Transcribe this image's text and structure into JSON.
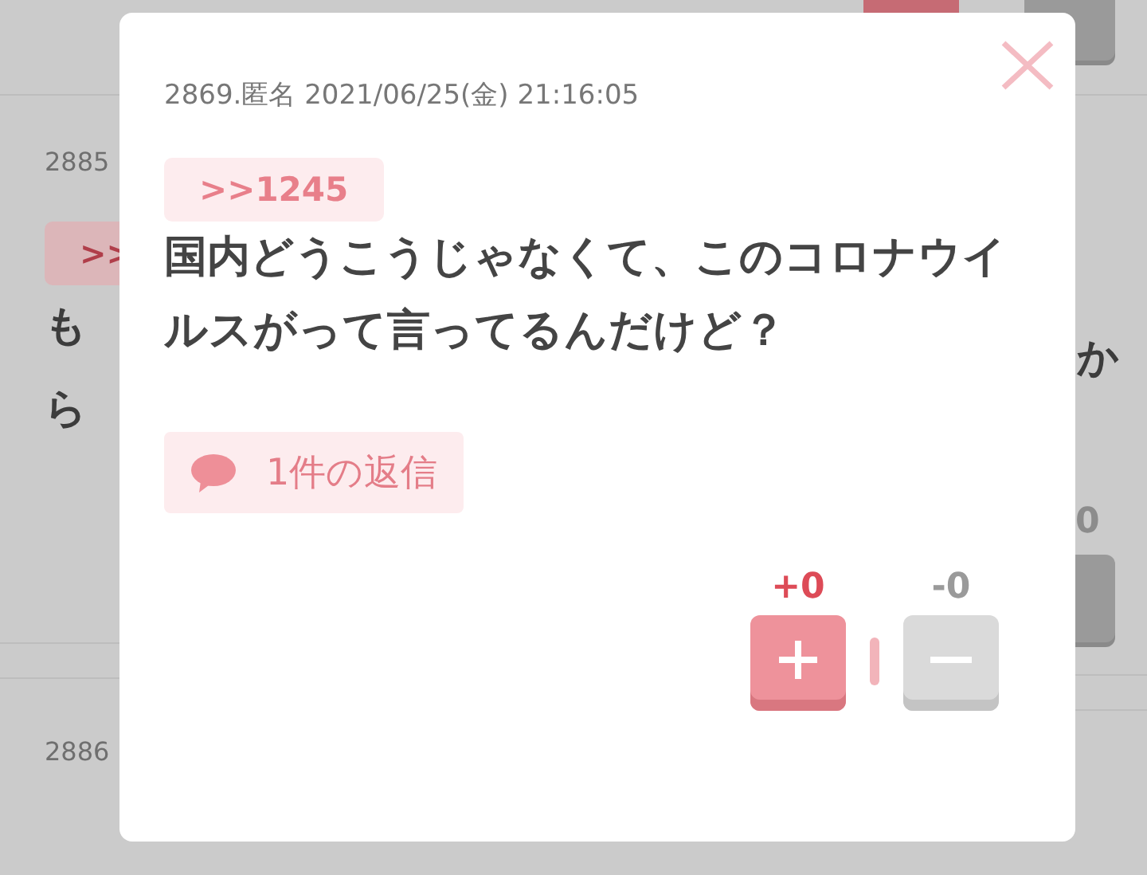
{
  "background_posts": [
    {
      "number": "2885",
      "reply_tag": ">>",
      "text_line1_start": "も",
      "text_line1_end": "か",
      "text_line2": "ら",
      "minus_count": "0"
    },
    {
      "number": "2886"
    }
  ],
  "modal": {
    "meta": "2869.匿名 2021/06/25(金) 21:16:05",
    "reply_tag": ">>1245",
    "body": "国内どうこうじゃなくて、このコロナウイルスがって言ってるんだけど？",
    "replies_button": "1件の返信",
    "plus_count": "+0",
    "minus_count": "-0"
  }
}
